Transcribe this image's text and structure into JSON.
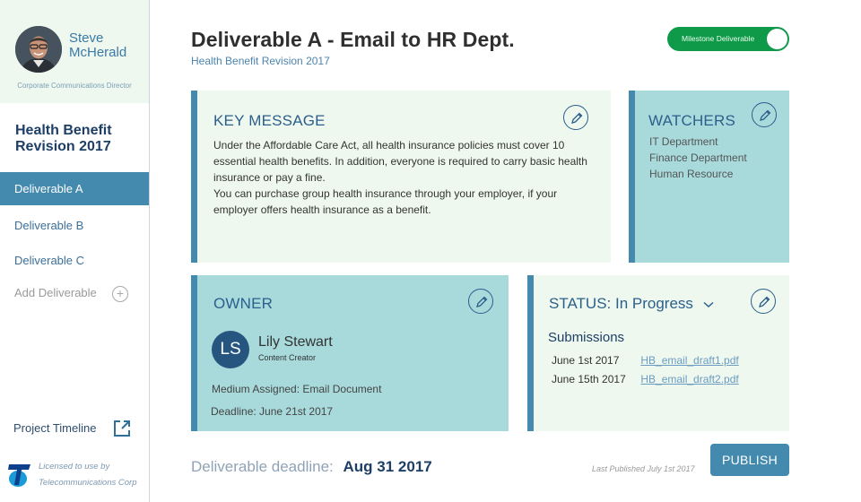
{
  "user": {
    "first_name": "Steve",
    "last_name": "McHerald",
    "role": "Corporate Communications Director"
  },
  "sidebar": {
    "project_title_line1": "Health Benefit",
    "project_title_line2": "Revision 2017",
    "items": [
      {
        "label": "Deliverable A",
        "active": true
      },
      {
        "label": "Deliverable B",
        "active": false
      },
      {
        "label": "Deliverable C",
        "active": false
      }
    ],
    "add_label": "Add Deliverable",
    "timeline_label": "Project Timeline",
    "license_line1": "Licensed to use by",
    "license_line2": "Telecommunications Corp"
  },
  "header": {
    "title": "Deliverable A - Email to HR Dept.",
    "subtitle": "Health Benefit Revision 2017",
    "milestone_label": "Milestone Deliverable",
    "milestone_on": true
  },
  "key_message": {
    "heading": "KEY MESSAGE",
    "paragraph1": "Under the Affordable Care Act, all health insurance policies must cover 10 essential health benefits. In addition, everyone is required to carry basic health insurance or pay a fine.",
    "paragraph2": "You can purchase group health insurance through your employer, if your employer offers health insurance as a benefit."
  },
  "watchers": {
    "heading": "WATCHERS",
    "items": [
      "IT Department",
      "Finance Department",
      "Human Resource"
    ]
  },
  "owner": {
    "heading": "OWNER",
    "initials": "LS",
    "name": "Lily Stewart",
    "role": "Content Creator",
    "medium": "Medium Assigned:  Email Document",
    "deadline": "Deadline: June 21st 2017"
  },
  "status": {
    "heading": "STATUS:  In Progress",
    "submissions_title": "Submissions",
    "submissions": [
      {
        "date": "June 1st 2017",
        "file": "HB_email_draft1.pdf"
      },
      {
        "date": "June 15th 2017",
        "file": "HB_email_draft2.pdf"
      }
    ]
  },
  "footer": {
    "deadline_label": "Deliverable deadline:",
    "deadline_value": "Aug 31 2017",
    "last_published": "Last Published July 1st 2017",
    "publish_label": "PUBLISH"
  },
  "colors": {
    "accent": "#438aae",
    "navy": "#1d3f66",
    "card_light": "#eef8ee",
    "card_teal": "#a8dadb",
    "milestone_green": "#0f9a4a"
  }
}
